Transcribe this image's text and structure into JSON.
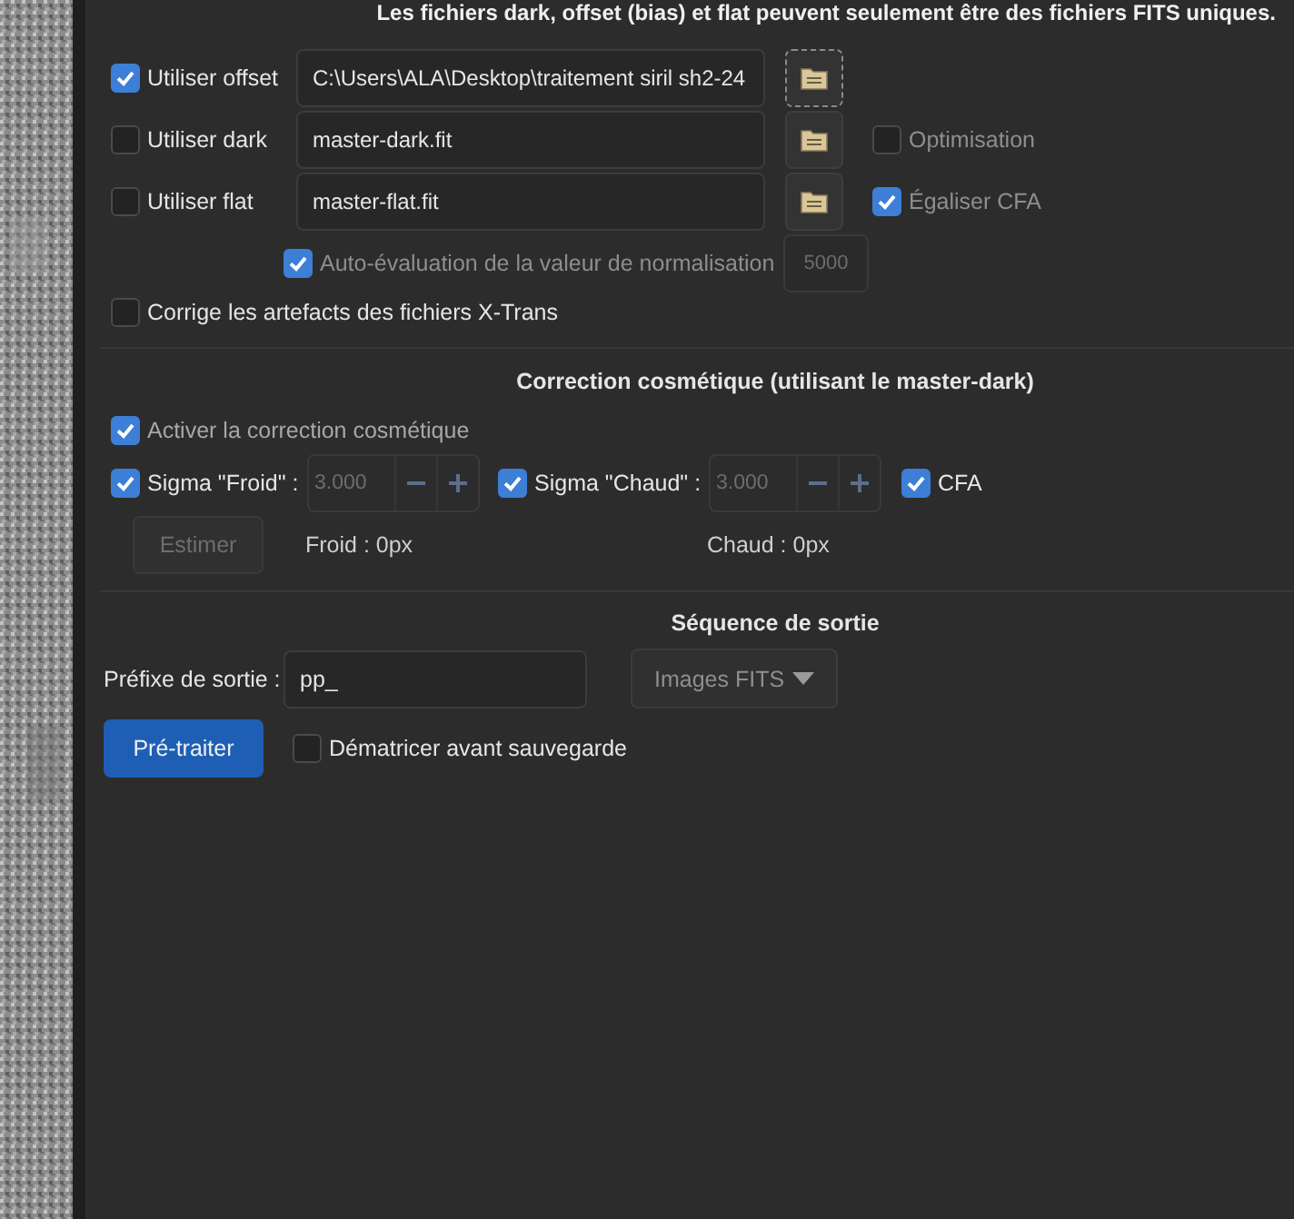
{
  "notice": "Les fichiers dark, offset (bias) et flat peuvent seulement être des fichiers FITS uniques.",
  "calibration_rows": [
    {
      "label": "Utiliser offset",
      "checked": true,
      "path": "C:\\Users\\ALA\\Desktop\\traitement siril sh2-24",
      "browse_focused": true
    },
    {
      "label": "Utiliser dark",
      "checked": false,
      "path": "master-dark.fit",
      "browse_focused": false,
      "option": {
        "label": "Optimisation",
        "checked": false,
        "disabled": true
      }
    },
    {
      "label": "Utiliser flat",
      "checked": false,
      "path": "master-flat.fit",
      "browse_focused": false,
      "option": {
        "label": "Égaliser CFA",
        "checked": true,
        "disabled": true
      }
    }
  ],
  "normalization": {
    "label": "Auto-évaluation de la valeur de normalisation",
    "checked": true,
    "disabled": true,
    "value": "5000"
  },
  "xtrans": {
    "label": "Corrige les artefacts des fichiers X-Trans",
    "checked": false
  },
  "cosmetic": {
    "title": "Correction cosmétique (utilisant le master-dark)",
    "enable": {
      "label": "Activer la correction cosmétique",
      "checked": true,
      "disabled": true
    },
    "sigmas": [
      {
        "label": "Sigma \"Froid\" :",
        "checked": true,
        "value": "3.000"
      },
      {
        "label": "Sigma \"Chaud\" :",
        "checked": true,
        "value": "3.000"
      }
    ],
    "cfa": {
      "label": "CFA",
      "checked": true
    },
    "estimate_button": {
      "label": "Estimer",
      "disabled": true
    },
    "readings": [
      "Froid : 0px",
      "Chaud : 0px"
    ]
  },
  "output": {
    "title": "Séquence de sortie",
    "prefix_label": "Préfixe de sortie :",
    "prefix_value": "pp_",
    "format": {
      "value": "Images FITS",
      "disabled": true
    },
    "run_button": "Pré-traiter",
    "debayer": {
      "label": "Dématricer avant sauvegarde",
      "checked": false
    }
  }
}
